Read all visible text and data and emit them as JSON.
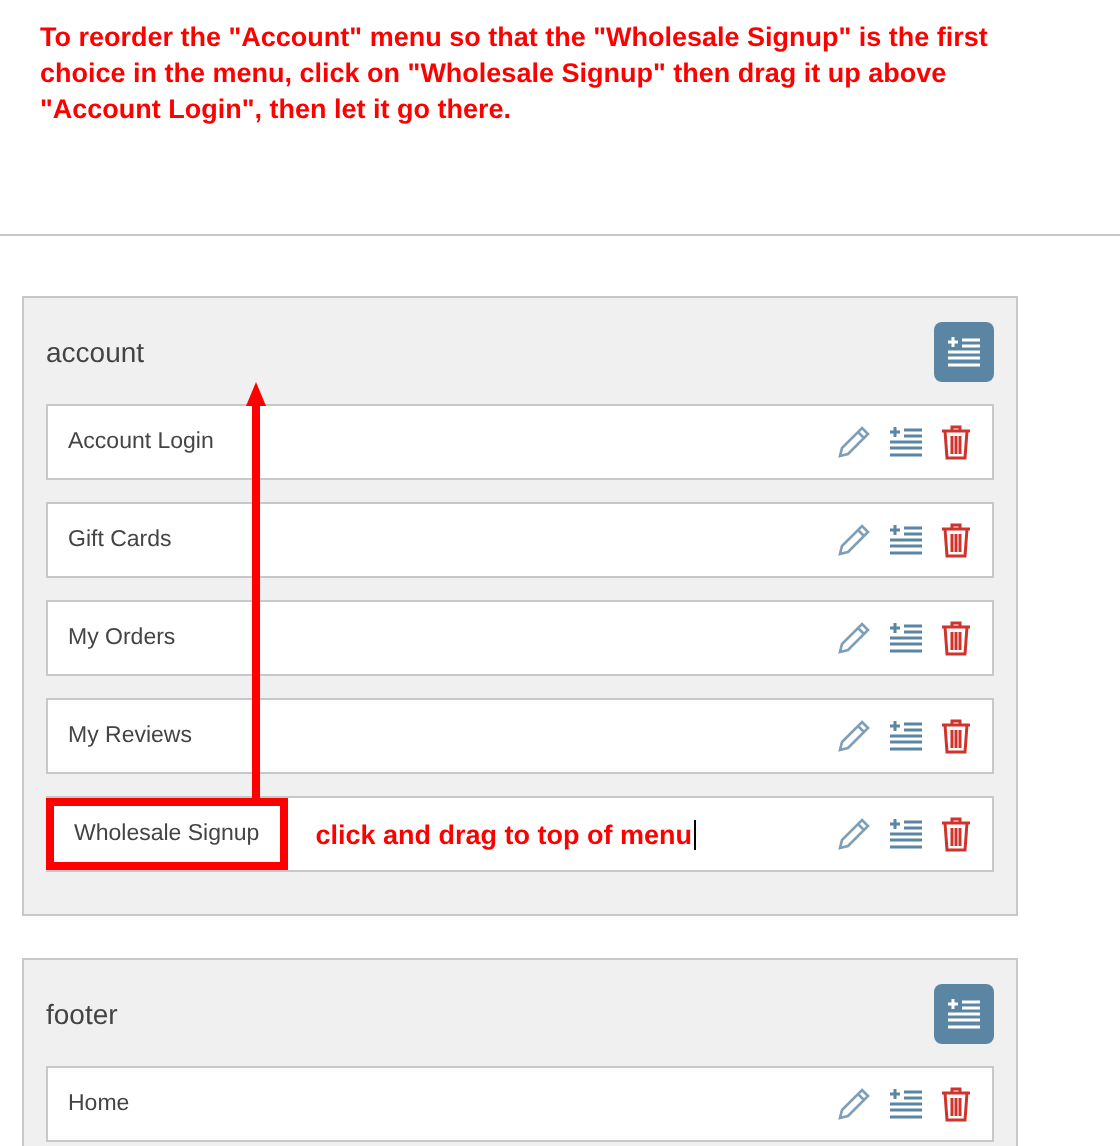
{
  "instruction": "To reorder the \"Account\" menu so that the \"Wholesale Signup\" is the first choice in the menu, click on \"Wholesale Signup\" then drag it up above \"Account Login\", then let it go there.",
  "menus": [
    {
      "title": "account",
      "items": [
        {
          "label": "Account Login",
          "highlighted": false
        },
        {
          "label": "Gift Cards",
          "highlighted": false
        },
        {
          "label": "My Orders",
          "highlighted": false
        },
        {
          "label": "My Reviews",
          "highlighted": false
        },
        {
          "label": "Wholesale Signup",
          "highlighted": true,
          "annotation": "click and drag to top of menu"
        }
      ]
    },
    {
      "title": "footer",
      "items": [
        {
          "label": "Home",
          "highlighted": false
        }
      ]
    }
  ]
}
